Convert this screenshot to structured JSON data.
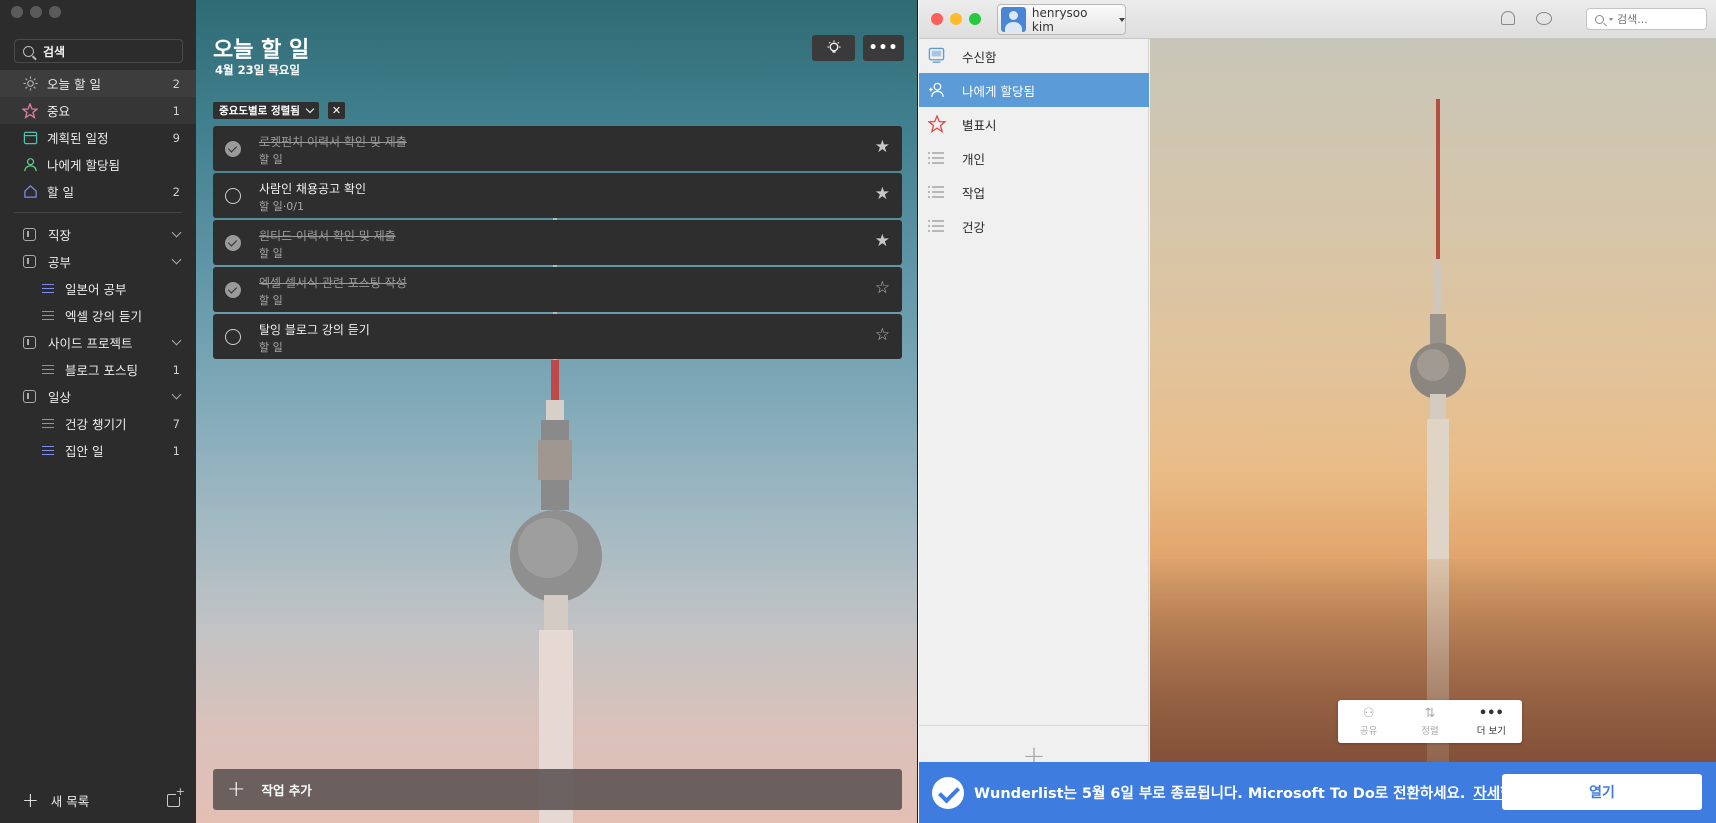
{
  "todo": {
    "search": {
      "label": "검색"
    },
    "nav": [
      {
        "label": "오늘 할 일",
        "count": "2",
        "icon": "sun-icon",
        "color": "#aaaaaa"
      },
      {
        "label": "중요",
        "count": "1",
        "icon": "star-icon",
        "color": "#e07fa8"
      },
      {
        "label": "계획된 일정",
        "count": "9",
        "icon": "calendar-icon",
        "color": "#4fc3b0"
      },
      {
        "label": "나에게 할당됨",
        "count": "",
        "icon": "person-icon",
        "color": "#5fd18f"
      },
      {
        "label": "할 일",
        "count": "2",
        "icon": "home-icon",
        "color": "#7b8ee8"
      }
    ],
    "groups": [
      {
        "label": "직장",
        "lists": []
      },
      {
        "label": "공부",
        "lists": [
          {
            "label": "일본어 공부",
            "count": ""
          },
          {
            "label": "엑셀 강의 듣기",
            "count": ""
          }
        ]
      },
      {
        "label": "사이드 프로젝트",
        "lists": [
          {
            "label": "블로그 포스팅",
            "count": "1"
          }
        ]
      },
      {
        "label": "일상",
        "lists": [
          {
            "label": "건강 챙기기",
            "count": "7"
          },
          {
            "label": "집안 일",
            "count": "1"
          }
        ]
      }
    ],
    "new_list_label": "새 목록",
    "main": {
      "title": "오늘 할 일",
      "date": "4월 23일 목요일",
      "sort_chip": "중요도별로 정렬됨",
      "add_task_label": "작업 추가"
    },
    "tasks": [
      {
        "title": "로켓펀치 이력서 확인 및 제출",
        "sub": "할 일",
        "done": true,
        "starred": true
      },
      {
        "title": "사람인 채용공고 확인",
        "sub": "할 일·0/1",
        "done": false,
        "starred": true
      },
      {
        "title": "원티드 이력서 확인 및 제출",
        "sub": "할 일",
        "done": true,
        "starred": true
      },
      {
        "title": "엑셀 셀서식 관련 포스팅 작성",
        "sub": "할 일",
        "done": true,
        "starred": false
      },
      {
        "title": "탈잉 블로그 강의 듣기",
        "sub": "할 일",
        "done": false,
        "starred": false
      }
    ]
  },
  "wunderlist": {
    "user": "henrysoo kim",
    "search_placeholder": "검색...",
    "lists": [
      {
        "label": "수신함",
        "icon": "inbox-icon",
        "active": false
      },
      {
        "label": "나에게 할당됨",
        "icon": "assigned-icon",
        "active": true
      },
      {
        "label": "별표시",
        "icon": "star-icon",
        "active": false
      },
      {
        "label": "개인",
        "icon": "list-icon",
        "active": false
      },
      {
        "label": "작업",
        "icon": "list-icon",
        "active": false
      },
      {
        "label": "건강",
        "icon": "list-icon",
        "active": false
      }
    ],
    "toolbar": {
      "share": "공유",
      "sort": "정렬",
      "more": "더 보기"
    },
    "banner": {
      "message": "Wunderlist는 5월 6일 부로 종료됩니다. Microsoft To Do로 전환하세요.",
      "link": "자세한 정보",
      "open_button": "열기"
    },
    "accent_color": "#3e7ce0",
    "active_color": "#5b9bd8"
  }
}
